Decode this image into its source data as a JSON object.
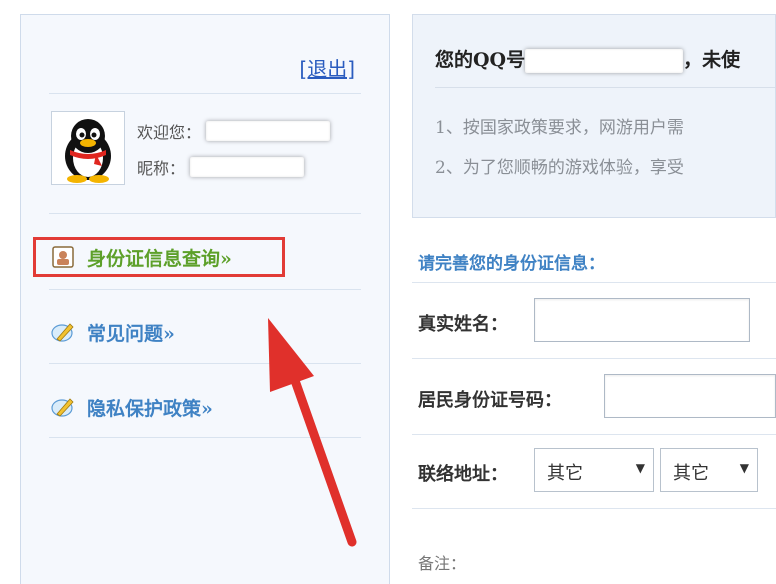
{
  "sidebar": {
    "logout_label": "[退出]",
    "welcome_label": "欢迎您：",
    "nickname_label": "昵称：",
    "items": [
      {
        "label": "身份证信息查询»",
        "icon": "id-card-icon",
        "active": true
      },
      {
        "label": "常见问题»",
        "icon": "pencil-icon",
        "active": false
      },
      {
        "label": "隐私保护政策»",
        "icon": "pencil-icon",
        "active": false
      }
    ]
  },
  "notice": {
    "qq_prefix": "您的QQ号",
    "qq_suffix": "，未使",
    "lines": [
      "1、按国家政策要求，网游用户需",
      "2、为了您顺畅的游戏体验，享受"
    ]
  },
  "form": {
    "title": "请完善您的身份证信息：",
    "name_label": "真实姓名：",
    "id_label": "居民身份证号码：",
    "address_label": "联络地址：",
    "address_selects": [
      "其它",
      "其它"
    ],
    "note_label": "备注："
  },
  "colors": {
    "accent_blue": "#3f82c4",
    "active_green": "#5da02a",
    "highlight_red": "#e23b36",
    "arrow_red": "#e0302b"
  }
}
